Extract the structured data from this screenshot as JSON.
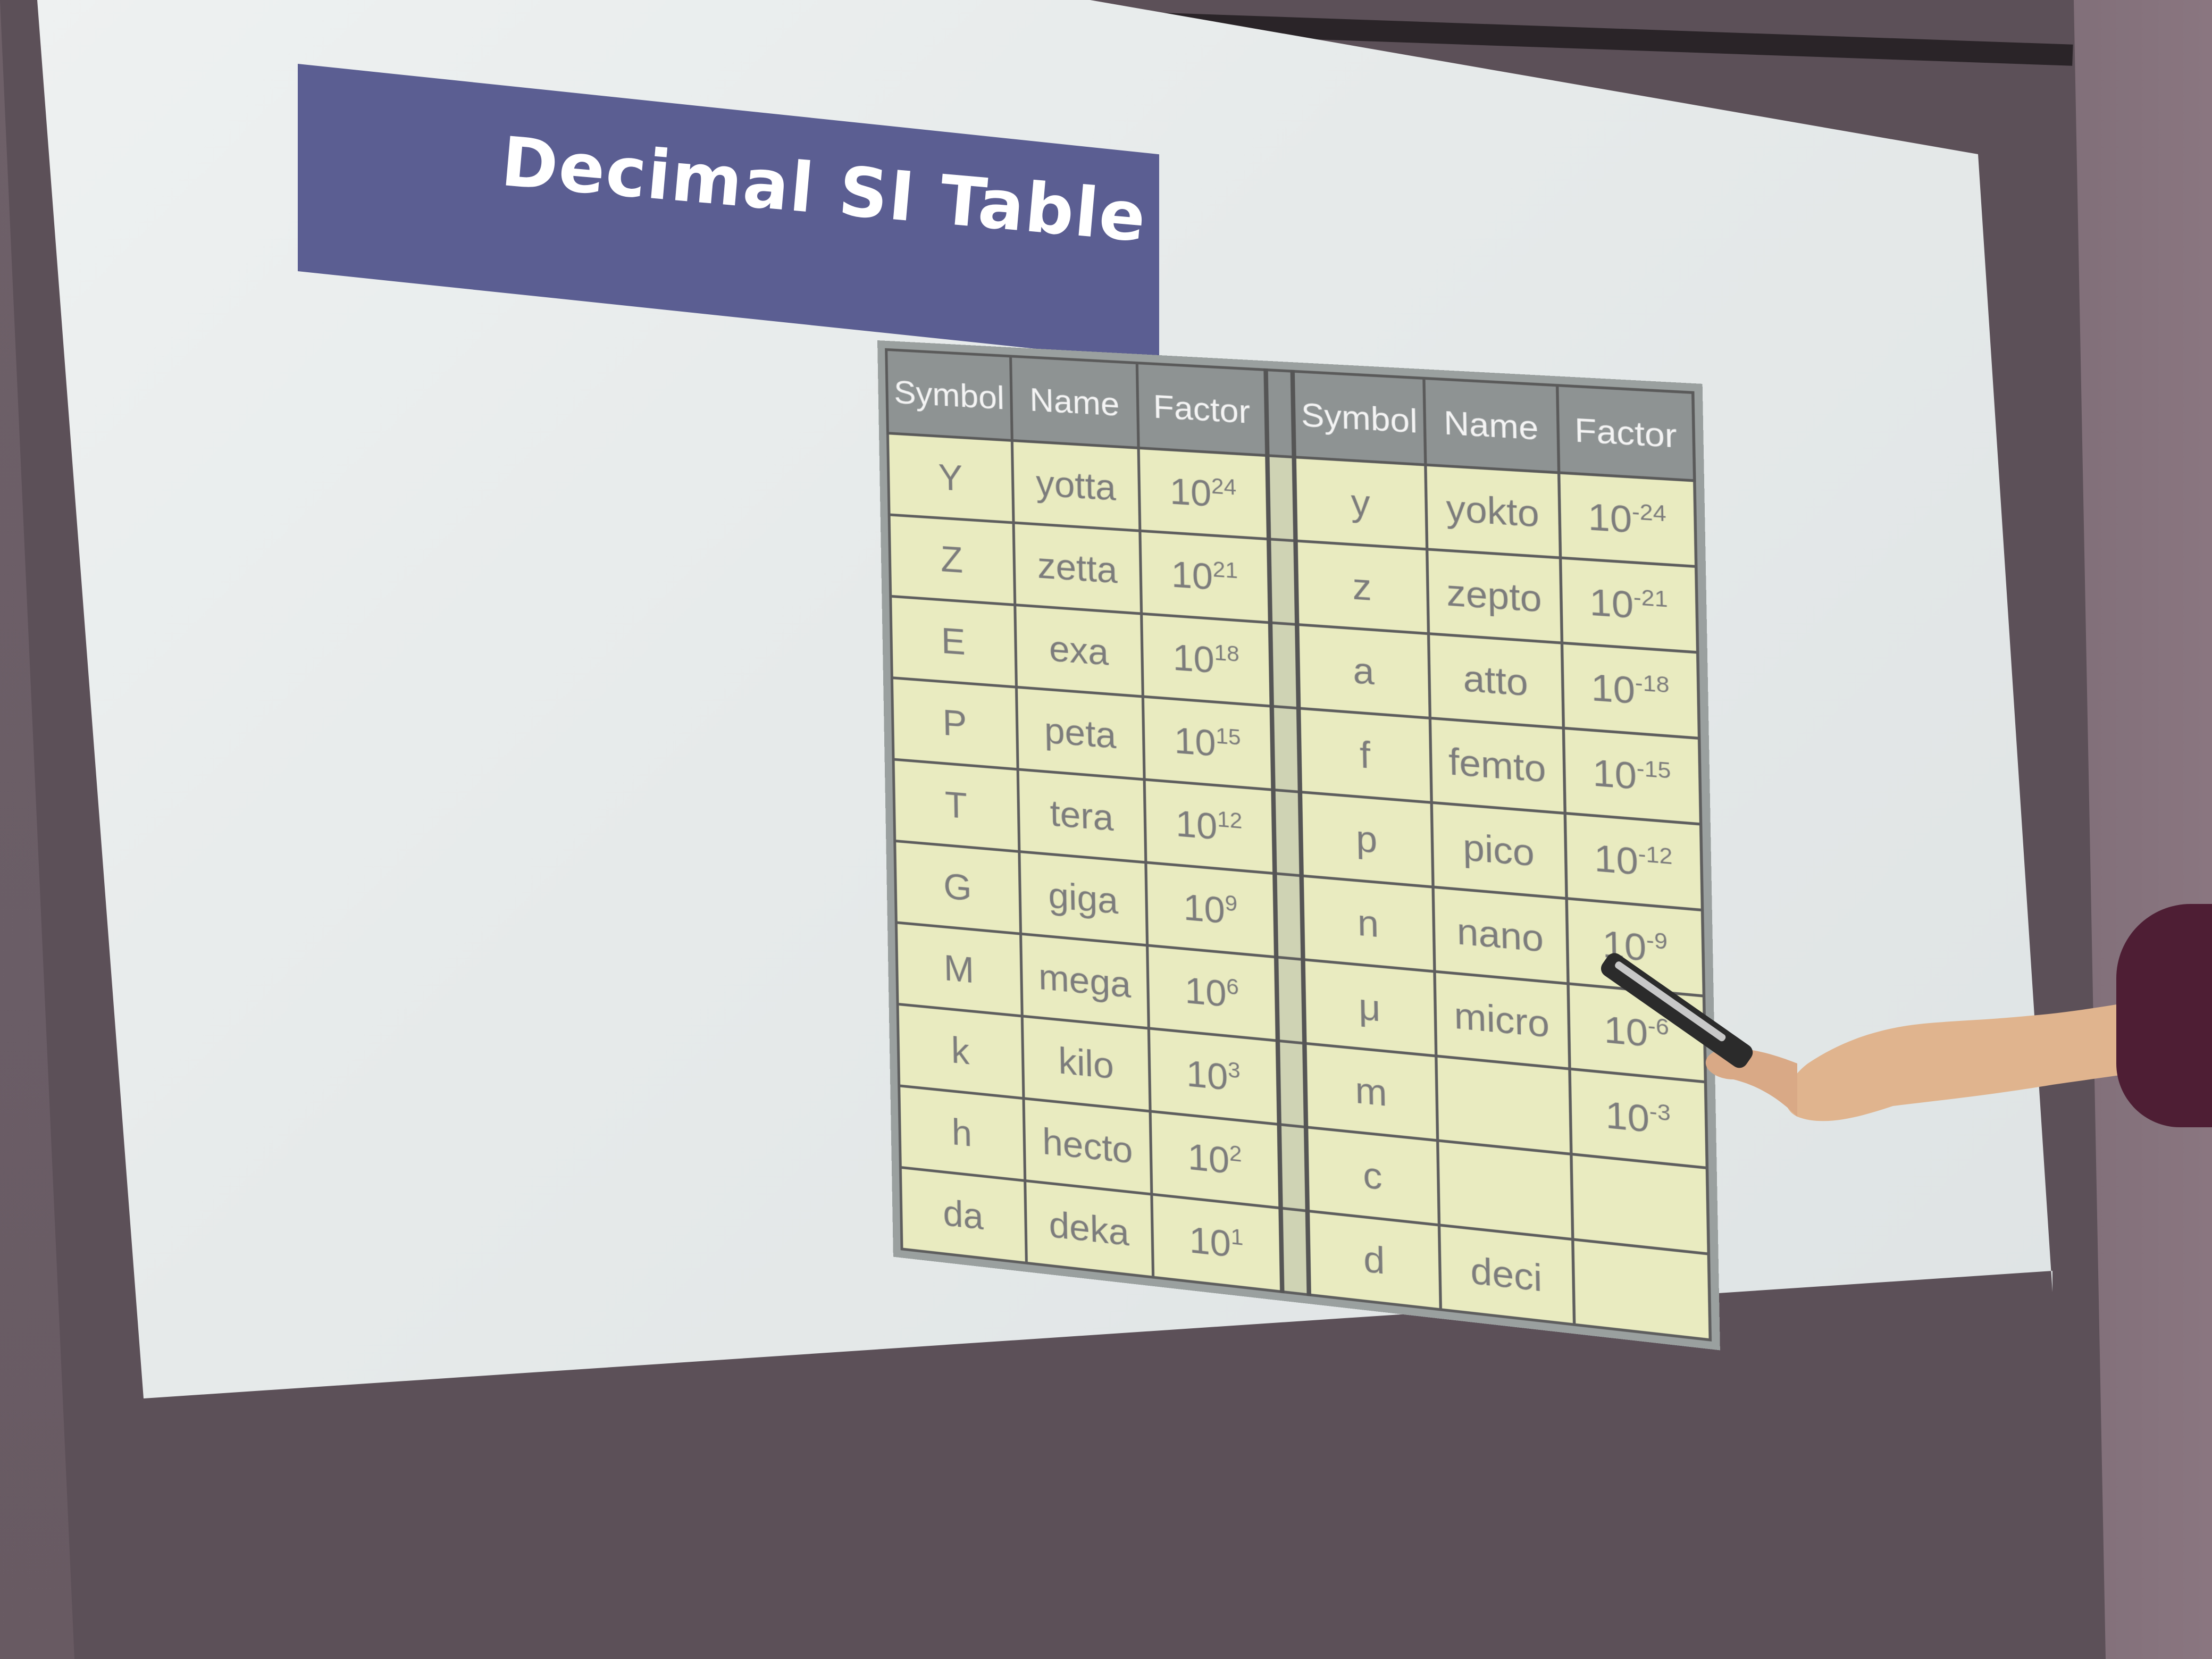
{
  "slide": {
    "title": "Decimal SI Table"
  },
  "table": {
    "headers": [
      "Symbol",
      "Name",
      "Factor",
      "Symbol",
      "Name",
      "Factor"
    ],
    "rows": [
      {
        "s1": "Y",
        "n1": "yotta",
        "b1": "10",
        "e1": "24",
        "s2": "y",
        "n2": "yokto",
        "b2": "10",
        "e2": "-24"
      },
      {
        "s1": "Z",
        "n1": "zetta",
        "b1": "10",
        "e1": "21",
        "s2": "z",
        "n2": "zepto",
        "b2": "10",
        "e2": "-21"
      },
      {
        "s1": "E",
        "n1": "exa",
        "b1": "10",
        "e1": "18",
        "s2": "a",
        "n2": "atto",
        "b2": "10",
        "e2": "-18"
      },
      {
        "s1": "P",
        "n1": "peta",
        "b1": "10",
        "e1": "15",
        "s2": "f",
        "n2": "femto",
        "b2": "10",
        "e2": "-15"
      },
      {
        "s1": "T",
        "n1": "tera",
        "b1": "10",
        "e1": "12",
        "s2": "p",
        "n2": "pico",
        "b2": "10",
        "e2": "-12"
      },
      {
        "s1": "G",
        "n1": "giga",
        "b1": "10",
        "e1": "9",
        "s2": "n",
        "n2": "nano",
        "b2": "10",
        "e2": "-9"
      },
      {
        "s1": "M",
        "n1": "mega",
        "b1": "10",
        "e1": "6",
        "s2": "μ",
        "n2": "micro",
        "b2": "10",
        "e2": "-6"
      },
      {
        "s1": "k",
        "n1": "kilo",
        "b1": "10",
        "e1": "3",
        "s2": "m",
        "n2": "",
        "b2": "10",
        "e2": "-3"
      },
      {
        "s1": "h",
        "n1": "hecto",
        "b1": "10",
        "e1": "2",
        "s2": "c",
        "n2": "",
        "b2": "",
        "e2": ""
      },
      {
        "s1": "da",
        "n1": "deka",
        "b1": "10",
        "e1": "1",
        "s2": "d",
        "n2": "deci",
        "b2": "",
        "e2": ""
      }
    ]
  },
  "colors": {
    "title_band": "#5b5e92",
    "table_header": "#8e9393",
    "table_cell": "#e9ebc0",
    "sleeve": "#4e1e34",
    "skin": "#e0b48e"
  }
}
